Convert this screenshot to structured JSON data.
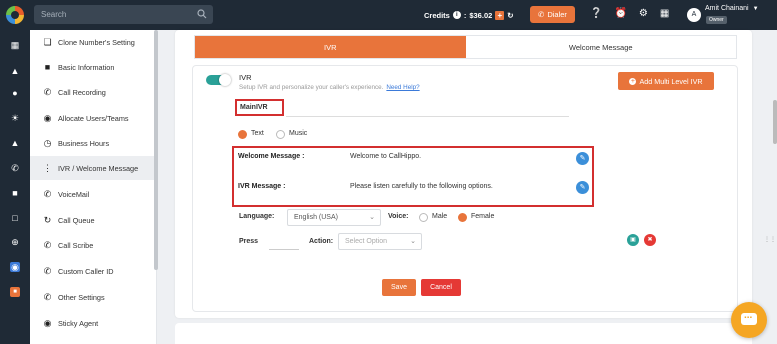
{
  "topbar": {
    "search_placeholder": "Search",
    "credits_label": "Credits",
    "credits_value": "$36.02",
    "dialer_label": "Dialer",
    "user_name": "Amit Chainani",
    "user_role": "Owner",
    "avatar_initial": "A"
  },
  "rail_icons": [
    "dashboard-icon",
    "building-icon",
    "users-icon",
    "sun-icon",
    "warning-icon",
    "phone-icon",
    "chat-icon",
    "document-icon",
    "plus-circle-icon",
    "settings-icon",
    "app-icon"
  ],
  "submenu": {
    "items": [
      {
        "label": "Clone Number's Setting",
        "icon": "clone-icon"
      },
      {
        "label": "Basic Information",
        "icon": "briefcase-icon"
      },
      {
        "label": "Call Recording",
        "icon": "phone-recording-icon"
      },
      {
        "label": "Allocate Users/Teams",
        "icon": "user-circle-icon"
      },
      {
        "label": "Business Hours",
        "icon": "clock-icon"
      },
      {
        "label": "IVR / Welcome Message",
        "icon": "dialpad-icon"
      },
      {
        "label": "VoiceMail",
        "icon": "voicemail-icon"
      },
      {
        "label": "Call Queue",
        "icon": "queue-icon"
      },
      {
        "label": "Call Scribe",
        "icon": "scribe-icon"
      },
      {
        "label": "Custom Caller ID",
        "icon": "caller-id-icon"
      },
      {
        "label": "Other Settings",
        "icon": "phone-settings-icon"
      },
      {
        "label": "Sticky Agent",
        "icon": "agent-icon"
      }
    ],
    "active_index": 5
  },
  "tabs": {
    "ivr": "IVR",
    "welcome": "Welcome Message"
  },
  "ivr": {
    "title": "IVR",
    "subtitle": "Setup IVR and personalize your caller's experience.",
    "help_link": "Need Help?",
    "add_multi_level": "Add Multi Level IVR",
    "name_value": "MainIVR",
    "type_text": "Text",
    "type_music": "Music",
    "selected_type": "Text"
  },
  "messages": {
    "welcome_label": "Welcome Message :",
    "welcome_text": "Welcome to CallHippo.",
    "ivr_label": "IVR Message :",
    "ivr_text": "Please listen carefully to the following options."
  },
  "settings": {
    "language_label": "Language:",
    "language_value": "English (USA)",
    "voice_label": "Voice:",
    "voice_male": "Male",
    "voice_female": "Female",
    "selected_voice": "Female",
    "press_label": "Press",
    "action_label": "Action:",
    "action_placeholder": "Select Option"
  },
  "buttons": {
    "save": "Save",
    "cancel": "Cancel"
  },
  "colors": {
    "accent": "#e8743b",
    "danger": "#e53935",
    "highlight_border": "#d32f2f",
    "toggle_on": "#2aa198",
    "dark_nav": "#1f2a36"
  }
}
